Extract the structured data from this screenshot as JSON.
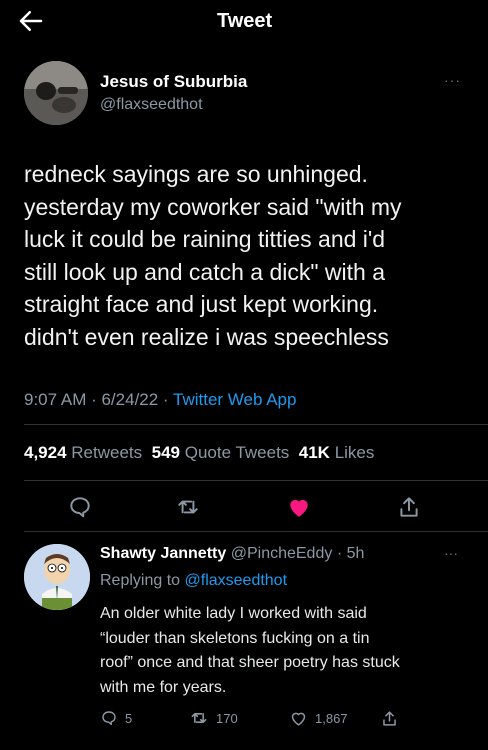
{
  "header": {
    "title": "Tweet"
  },
  "tweet": {
    "name": "Jesus of Suburbia",
    "handle": "@flaxseedthot",
    "more": "···",
    "text_lines": [
      "redneck sayings are so unhinged.",
      "yesterday my coworker said \"with my",
      "luck it could be raining titties and i'd",
      "still look up and catch a dick\" with a",
      "straight face and just kept working.",
      "didn't even realize i was speechless"
    ],
    "time": "9:07 AM · 6/24/22 · ",
    "source": "Twitter Web App",
    "retweets_count": "4,924",
    "retweets_label": "Retweets",
    "quotes_count": "549",
    "quotes_label": "Quote Tweets",
    "likes_count": "41K",
    "likes_label": "Likes"
  },
  "colors": {
    "accent": "#1d9bf0",
    "like": "#f91880",
    "muted": "#8b98a5",
    "background": "#000000"
  },
  "icons": {
    "back": "arrow-left-icon",
    "reply": "comment-icon",
    "retweet": "retweet-icon",
    "like": "heart-filled-icon",
    "share": "share-icon",
    "more": "more-dots-icon"
  },
  "reply": {
    "name": "Shawty Jannetty",
    "handle": "@PincheEddy",
    "time": "· 5h",
    "more": "···",
    "replying_to_label": "Replying to",
    "replying_to_handle": "@flaxseedthot",
    "text_lines": [
      "An older white lady I worked with said",
      "“louder than skeletons fucking on a tin",
      "roof” once and that sheer poetry has stuck",
      "with me for years."
    ],
    "reply_count": "5",
    "retweet_count": "170",
    "like_count": "1,867"
  }
}
